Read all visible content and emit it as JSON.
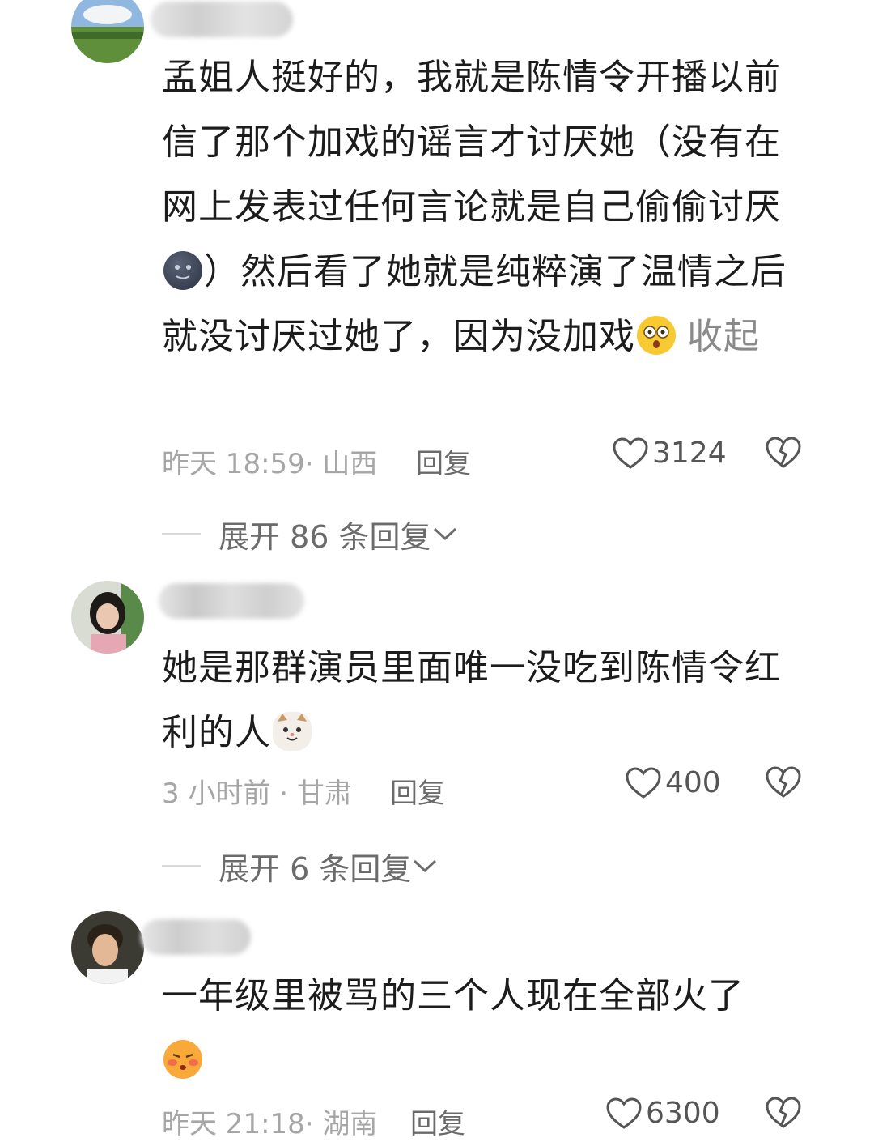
{
  "comments": [
    {
      "text_before_emoji1": "孟姐人挺好的，我就是陈情令开播以前信了那个加戏的谣言才讨厌她（没有在网上发表过任何言论就是自己偷偷讨厌",
      "text_after_emoji1": "）然后看了她就是纯粹演了温情之后就没讨厌过她了，因为没加戏",
      "collapse": "收起",
      "time_location": "昨天 18:59· 山西",
      "reply": "回复",
      "likes": "3124",
      "expand": "展开 86 条回复",
      "emoji1": "new-moon-face-icon",
      "emoji2": "shocked-face-icon"
    },
    {
      "text": "她是那群演员里面唯一没吃到陈情令红利的人",
      "emoji": "cat-face-icon",
      "time_location": "3 小时前 · 甘肃",
      "reply": "回复",
      "likes": "400",
      "expand": "展开 6 条回复"
    },
    {
      "text": "一年级里被骂的三个人现在全部火了",
      "emoji": "pouting-face-icon",
      "time_location": "昨天 21:18· 湖南",
      "reply": "回复",
      "likes": "6300"
    }
  ]
}
